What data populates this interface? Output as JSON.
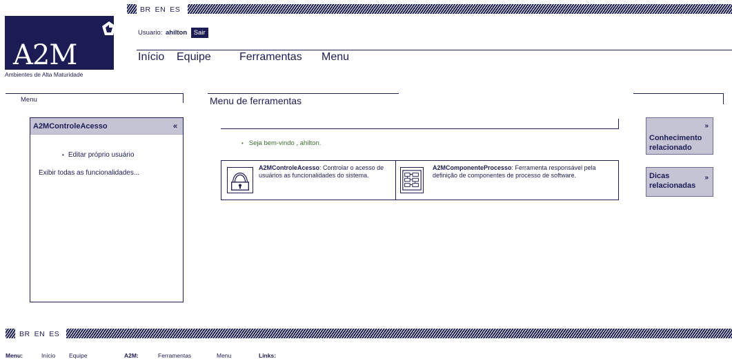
{
  "languages": [
    "BR",
    "EN",
    "ES"
  ],
  "logo": {
    "text": "A2M",
    "tagline": "Ambientes de Alta Maturidade"
  },
  "user": {
    "label": "Usuario:",
    "name": "ahilton",
    "logout_label": "Sair"
  },
  "main_nav": [
    "Início",
    "Equipe",
    "Ferramentas",
    "Menu"
  ],
  "left": {
    "section_title": "Menu",
    "panel_title": "A2MControleAcesso",
    "collapse_label": "«",
    "items": [
      "Editar próprio usuário"
    ],
    "show_all_label": "Exibir todas as funcionalidades..."
  },
  "center": {
    "title": "Menu de ferramentas",
    "welcome": "Seja bem-vindo , ahilton.",
    "tools": [
      {
        "name": "A2MControleAcesso",
        "desc": "Controlar o acesso de usuários as funcionalidades do sistema.",
        "icon": "lock-icon"
      },
      {
        "name": "A2MComponenteProcesso",
        "desc": "Ferramenta responsável pela definição de componentes de processo de software.",
        "icon": "process-components-icon"
      }
    ]
  },
  "right": {
    "boxes": [
      {
        "arrow": "»",
        "label": "Conhecimento relacionado"
      },
      {
        "arrow": "»",
        "label": "Dicas relacionadas"
      }
    ]
  },
  "footer": {
    "menu_label": "Menu:",
    "menu_items": [
      "Início",
      "Equipe"
    ],
    "a2m_label": "A2M:",
    "a2m_items": [
      "Ferramentas",
      "Menu"
    ],
    "links_label": "Links:"
  },
  "colors": {
    "primary": "#1c1c55",
    "panel_bg": "#c4c4d4",
    "welcome_text": "#3f6e2f"
  }
}
